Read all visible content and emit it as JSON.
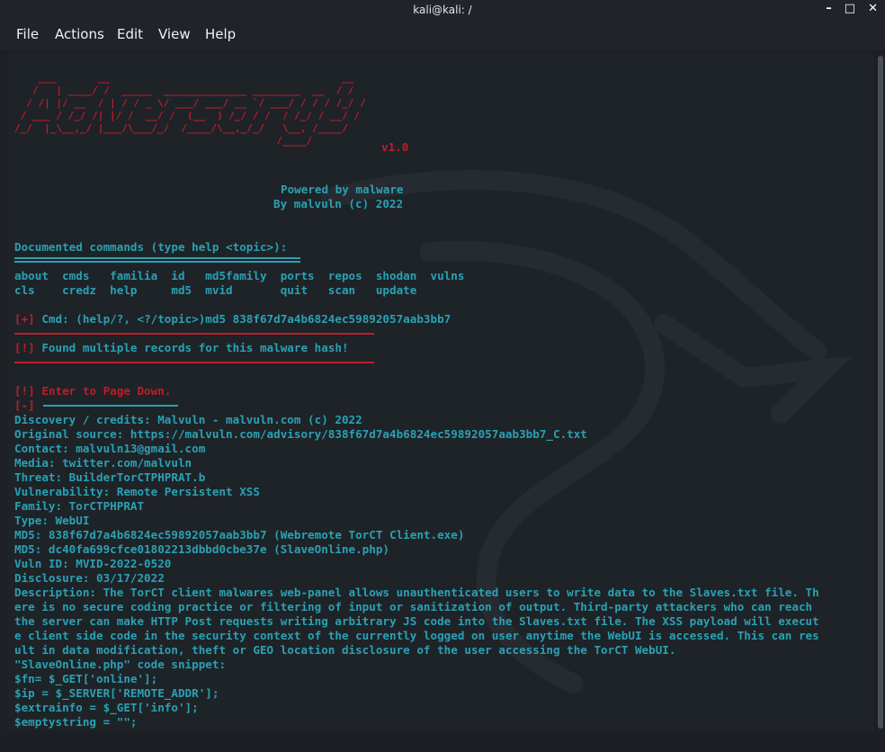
{
  "window": {
    "title": "kali@kali: /",
    "minimize": "–",
    "maximize": "□",
    "close": "✕"
  },
  "menu": [
    "File",
    "Actions",
    "Edit",
    "View",
    "Help"
  ],
  "banner": {
    "art": "    ___       __                                       __\n   /   | ____/ /  _____  ______________ ________  __  / /\n  / /| |/ __  / | / / _ \\/ ___/ ___/ __ `/ ___/ / / / /_/ /\n / ___ / /_/ /| |/ /  __/ /  (__  ) /_/ / /  / /_/ / __/ /\n/_/  |_\\__,_/ |___/\\___/_/  /____/\\__,_/_/   \\__, /____/\n                                            /____/",
    "version": "v1.0"
  },
  "powered": "Powered by malware",
  "by": "By malvuln (c) 2022",
  "documented": "Documented commands (type help <topic>):",
  "rule": "========================================",
  "commands_row1": "about  cmds   familia  id   md5family  ports  repos  shodan  vulns",
  "commands_row2": "cls    credz  help     md5  mvid       quit   scan   update",
  "cmd_prefix": "[+]",
  "cmd_line": " Cmd: (help/?, <?/topic>)md5 838f67d7a4b6824ec59892057aab3bb7",
  "box_top": "+-----------------------------------------------------+",
  "found_prefix": "[!]",
  "found_text": " Found multiple records for this malware hash!",
  "box_bottom": "+-----------------------------------------------------+",
  "enter_line": "[!] Enter to Page Down.",
  "minus_prefix": "[-]",
  "minus_box": " +-------------------+",
  "details": [
    "Discovery / credits: Malvuln - malvuln.com (c) 2022",
    "Original source: https://malvuln.com/advisory/838f67d7a4b6824ec59892057aab3bb7_C.txt",
    "Contact: malvuln13@gmail.com",
    "Media: twitter.com/malvuln",
    "Threat: BuilderTorCTPHPRAT.b",
    "Vulnerability: Remote Persistent XSS",
    "Family: TorCTPHPRAT",
    "Type: WebUI",
    "MD5: 838f67d7a4b6824ec59892057aab3bb7 (Webremote TorCT Client.exe)",
    "MD5: dc40fa699cfce01802213dbbd0cbe37e (SlaveOnline.php)",
    "Vuln ID: MVID-2022-0520",
    "Disclosure: 03/17/2022",
    "Description: The TorCT client malwares web-panel allows unauthenticated users to write data to the Slaves.txt file. Th",
    "ere is no secure coding practice or filtering of input or sanitization of output. Third-party attackers who can reach",
    "the server can make HTTP Post requests writing arbitrary JS code into the Slaves.txt file. The XSS payload will execut",
    "e client side code in the security context of the currently logged on user anytime the WebUI is accessed. This can res",
    "ult in data modification, theft or GEO location disclosure of the user accessing the TorCT WebUI.",
    "\"SlaveOnline.php\" code snippet:",
    "$fn= $_GET['online'];",
    "$ip = $_SERVER['REMOTE_ADDR'];",
    "$extrainfo = $_GET['info'];",
    "$emptystring = \"\";"
  ]
}
